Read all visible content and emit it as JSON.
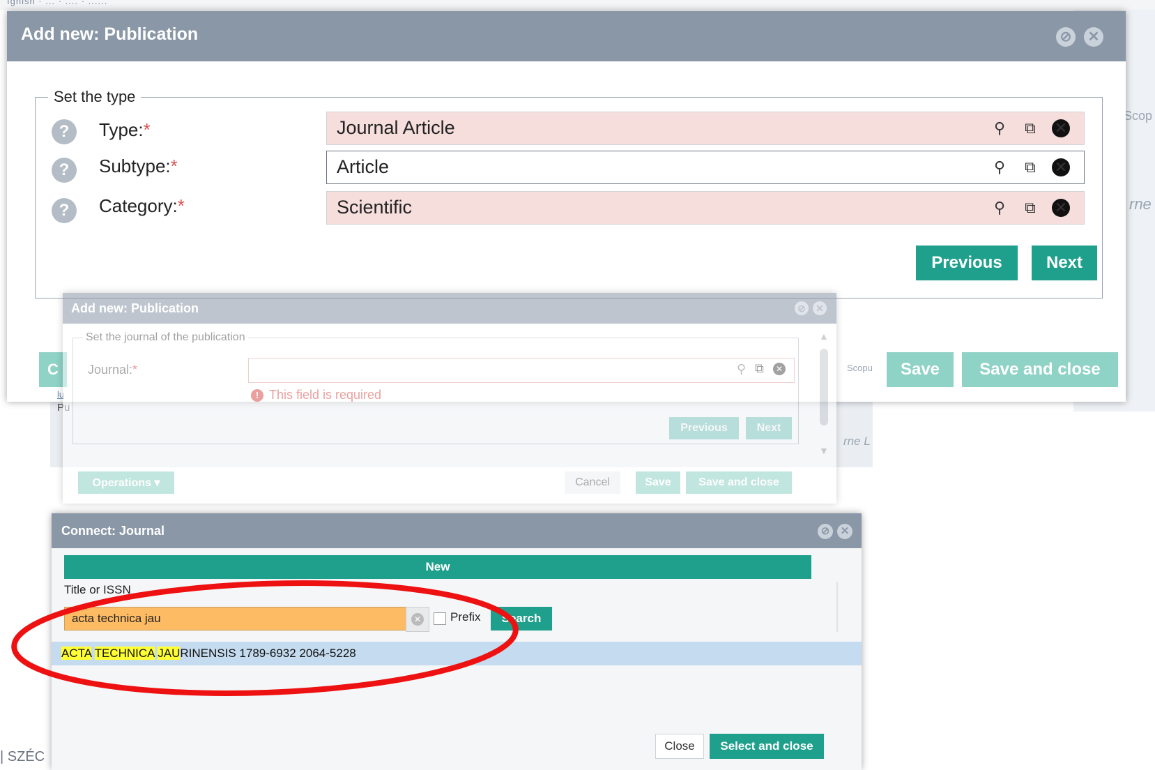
{
  "background": {
    "top_links": "ıgnlsh  ·  ...  ·  ....  ·  ......",
    "right_fragment_1": "Scop",
    "right_fragment_2": "rne",
    "footer_fragment": "SZÉC"
  },
  "dialog1": {
    "title": "Add new: Publication",
    "legend": "Set the type",
    "rows": [
      {
        "label": "Type:",
        "required_mark": "*",
        "value": "Journal Article"
      },
      {
        "label": "Subtype:",
        "required_mark": "*",
        "value": "Article"
      },
      {
        "label": "Category:",
        "required_mark": "*",
        "value": "Scientific"
      }
    ],
    "help_glyph": "?",
    "previous_label": "Previous",
    "next_label": "Next",
    "save_label": "Save",
    "save_and_close_label": "Save and close",
    "left_button_fragment": "C",
    "bottom_fragment_1": "lu",
    "bottom_fragment_2": "Pu",
    "side_scop": "Scopu",
    "side_rne": "rne L"
  },
  "dialog2": {
    "title": "Add new: Publication",
    "legend": "Set the journal of the publication",
    "journal_label": "Journal:",
    "required_mark": "*",
    "error_text": "This field is required",
    "error_glyph": "!",
    "previous_label": "Previous",
    "next_label": "Next",
    "operations_label": "Operations",
    "cancel_label": "Cancel",
    "save_label": "Save",
    "save_and_close_label": "Save and close"
  },
  "dialog3": {
    "title": "Connect: Journal",
    "new_label": "New",
    "search_field_label": "Title or ISSN",
    "search_value": "acta technica jau",
    "prefix_label": "Prefix",
    "search_button": "Search",
    "result": {
      "hl1": "ACTA",
      "sp1": " ",
      "hl2": "TECHNICA",
      "sp2": " ",
      "hl3": "JAU",
      "rest": "RINENSIS 1789-6932 2064-5228"
    },
    "close_label": "Close",
    "select_and_close_label": "Select and close"
  },
  "colors": {
    "header_gray": "#8a97a7",
    "teal": "#1fa08c",
    "required_red": "#d9534f",
    "field_pink": "#f6dedd",
    "search_orange": "#fdbb64",
    "result_blue": "#c5dcf0",
    "highlight_yellow": "#ffff33",
    "annotation_red": "#ee1111"
  },
  "icons": {
    "search": "search-icon",
    "open_link": "open-link-icon",
    "clear": "clear-circle-icon",
    "minimize": "minimize-icon",
    "close": "close-icon",
    "help": "help-icon",
    "error": "error-icon",
    "dropdown": "chevron-down-icon",
    "scroll_up": "scroll-up-icon",
    "scroll_down": "scroll-down-icon"
  }
}
